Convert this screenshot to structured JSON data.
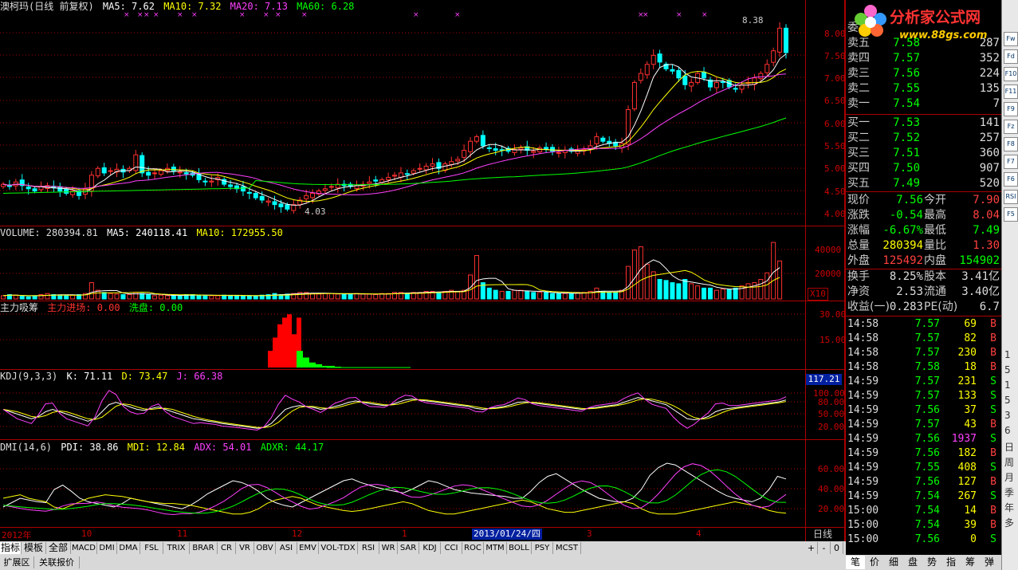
{
  "main_header": {
    "title": "澳柯玛(日线 前复权)",
    "ma5": "MA5: 7.62",
    "ma10": "MA10: 7.32",
    "ma20": "MA20: 7.13",
    "ma60": "MA60: 6.28"
  },
  "price_axis": [
    "8.00",
    "7.50",
    "7.00",
    "6.50",
    "6.00",
    "5.50",
    "5.00",
    "4.50",
    "4.00"
  ],
  "price_annotations": {
    "high": "8.38",
    "low": "4.03"
  },
  "volume_header": {
    "label": "VOLUME: 280394.81",
    "ma5": "MA5: 240118.41",
    "ma10": "MA10: 172955.50"
  },
  "volume_axis": [
    "40000",
    "20000"
  ],
  "volume_unit": "X10",
  "zljc_header": {
    "label": "主力吸筹",
    "in": "主力进场: 0.00",
    "out": "洗盘: 0.00"
  },
  "zljc_axis": [
    "30.00",
    "15.00"
  ],
  "kdj_header": {
    "label": "KDJ(9,3,3)",
    "k": "K: 71.11",
    "d": "D: 73.47",
    "j": "J: 66.38"
  },
  "kdj_axis": [
    "100.00",
    "80.00",
    "50.00",
    "20.00"
  ],
  "kdj_badge": "117.21",
  "dmi_header": {
    "label": "DMI(14,6)",
    "pdi": "PDI: 38.86",
    "mdi": "MDI: 12.84",
    "adx": "ADX: 54.01",
    "adxr": "ADXR: 44.17"
  },
  "dmi_axis": [
    "60.00",
    "40.00",
    "20.00"
  ],
  "date_axis": {
    "labels": [
      "2012年",
      "10",
      "11",
      "12",
      "1",
      "3",
      "4"
    ],
    "cursor_date": "2013/01/24/四",
    "period": "日线"
  },
  "indicator_tabs": [
    "指标",
    "模板",
    "全部",
    "MACD",
    "DMI",
    "DMA",
    "FSL",
    "TRIX",
    "BRAR",
    "CR",
    "VR",
    "OBV",
    "ASI",
    "EMV",
    "VOL-TDX",
    "RSI",
    "WR",
    "SAR",
    "KDJ",
    "CCI",
    "ROC",
    "MTM",
    "BOLL",
    "PSY",
    "MCST"
  ],
  "tab_controls": [
    "+",
    "-",
    "0"
  ],
  "bottom_tabs": [
    "扩展区",
    "关联报价"
  ],
  "logo": {
    "text": "分析家公式网",
    "url": "www.88gs.com"
  },
  "quote": {
    "wei": "委",
    "asks": [
      {
        "label": "卖五",
        "price": "7.58",
        "vol": "287"
      },
      {
        "label": "卖四",
        "price": "7.57",
        "vol": "352"
      },
      {
        "label": "卖三",
        "price": "7.56",
        "vol": "224"
      },
      {
        "label": "卖二",
        "price": "7.55",
        "vol": "135"
      },
      {
        "label": "卖一",
        "price": "7.54",
        "vol": "7"
      }
    ],
    "bids": [
      {
        "label": "买一",
        "price": "7.53",
        "vol": "141"
      },
      {
        "label": "买二",
        "price": "7.52",
        "vol": "257"
      },
      {
        "label": "买三",
        "price": "7.51",
        "vol": "360"
      },
      {
        "label": "买四",
        "price": "7.50",
        "vol": "907"
      },
      {
        "label": "买五",
        "price": "7.49",
        "vol": "520"
      }
    ],
    "stats": [
      {
        "l1": "现价",
        "v1": "7.56",
        "l2": "今开",
        "v2": "7.90"
      },
      {
        "l1": "涨跌",
        "v1": "-0.54",
        "l2": "最高",
        "v2": "8.04"
      },
      {
        "l1": "涨幅",
        "v1": "-6.67%",
        "l2": "最低",
        "v2": "7.49"
      },
      {
        "l1": "总量",
        "v1": "280394",
        "l2": "量比",
        "v2": "1.30"
      },
      {
        "l1": "外盘",
        "v1": "125492",
        "l2": "内盘",
        "v2": "154902"
      }
    ],
    "fund": [
      {
        "l1": "换手",
        "v1": "8.25%",
        "l2": "股本",
        "v2": "3.41亿"
      },
      {
        "l1": "净资",
        "v1": "2.53",
        "l2": "流通",
        "v2": "3.40亿"
      },
      {
        "l1": "收益(一)",
        "v1": "0.283",
        "l2": "PE(动)",
        "v2": "6.7"
      }
    ],
    "ticks": [
      {
        "t": "14:58",
        "p": "7.57",
        "v": "69",
        "s": "B"
      },
      {
        "t": "14:58",
        "p": "7.57",
        "v": "82",
        "s": "B"
      },
      {
        "t": "14:58",
        "p": "7.57",
        "v": "230",
        "s": "B"
      },
      {
        "t": "14:58",
        "p": "7.58",
        "v": "18",
        "s": "B"
      },
      {
        "t": "14:59",
        "p": "7.57",
        "v": "231",
        "s": "S"
      },
      {
        "t": "14:59",
        "p": "7.57",
        "v": "133",
        "s": "S"
      },
      {
        "t": "14:59",
        "p": "7.56",
        "v": "37",
        "s": "S"
      },
      {
        "t": "14:59",
        "p": "7.57",
        "v": "43",
        "s": "B"
      },
      {
        "t": "14:59",
        "p": "7.56",
        "v": "1937",
        "s": "S"
      },
      {
        "t": "14:59",
        "p": "7.56",
        "v": "182",
        "s": "B"
      },
      {
        "t": "14:59",
        "p": "7.55",
        "v": "408",
        "s": "S"
      },
      {
        "t": "14:59",
        "p": "7.56",
        "v": "127",
        "s": "B"
      },
      {
        "t": "14:59",
        "p": "7.54",
        "v": "267",
        "s": "S"
      },
      {
        "t": "15:00",
        "p": "7.54",
        "v": "14",
        "s": "B"
      },
      {
        "t": "15:00",
        "p": "7.54",
        "v": "39",
        "s": "B"
      },
      {
        "t": "15:00",
        "p": "7.56",
        "v": "0",
        "s": "S"
      }
    ],
    "bottom_tabs": [
      "笔",
      "价",
      "细",
      "盘",
      "势",
      "指",
      "筹",
      "弹"
    ]
  },
  "right_toolbar": {
    "buttons": [
      "Fw",
      "Fd",
      "F10",
      "F11",
      "F9",
      "Fz",
      "F8",
      "F7",
      "F6",
      "RSI",
      "F5"
    ],
    "chars": [
      "1",
      "5",
      "1",
      "5",
      "3",
      "6",
      "日",
      "周",
      "月",
      "季",
      "年",
      "多"
    ]
  },
  "colors": {
    "up": "#ff3030",
    "down": "#00ffff",
    "ma5": "#ffffff",
    "ma10": "#ffff00",
    "ma20": "#ff40ff",
    "ma60": "#00ff00",
    "grid": "#aa0000"
  },
  "chart_data": {
    "type": "candlestick",
    "price_range": [
      3.8,
      8.5
    ],
    "closes": [
      4.65,
      4.6,
      4.7,
      4.62,
      4.55,
      4.5,
      4.6,
      4.62,
      4.58,
      4.5,
      4.45,
      4.5,
      4.4,
      4.55,
      4.85,
      5.0,
      4.9,
      4.95,
      4.98,
      4.92,
      5.0,
      5.3,
      4.9,
      4.85,
      4.9,
      4.95,
      5.0,
      4.95,
      4.92,
      4.88,
      4.85,
      4.75,
      4.7,
      4.72,
      4.8,
      4.65,
      4.6,
      4.55,
      4.5,
      4.45,
      4.35,
      4.3,
      4.28,
      4.2,
      4.15,
      4.1,
      4.2,
      4.3,
      4.4,
      4.45,
      4.5,
      4.55,
      4.6,
      4.65,
      4.62,
      4.6,
      4.62,
      4.65,
      4.7,
      4.72,
      4.75,
      4.8,
      4.85,
      4.9,
      4.88,
      4.95,
      5.0,
      5.05,
      5.1,
      5.0,
      5.1,
      5.15,
      5.2,
      5.4,
      5.6,
      5.7,
      5.5,
      5.45,
      5.4,
      5.4,
      5.38,
      5.42,
      5.45,
      5.4,
      5.38,
      5.45,
      5.42,
      5.38,
      5.35,
      5.4,
      5.38,
      5.4,
      5.42,
      5.5,
      5.7,
      5.6,
      5.55,
      5.5,
      5.55,
      6.3,
      6.9,
      7.1,
      7.3,
      7.5,
      7.35,
      7.2,
      7.15,
      7.0,
      6.85,
      6.9,
      7.1,
      7.0,
      6.8,
      6.9,
      6.9,
      6.8,
      6.75,
      6.85,
      6.9,
      7.0,
      7.1,
      7.3,
      7.6,
      8.1,
      7.56
    ],
    "volume_range": [
      0,
      55000
    ],
    "volumes": [
      3000,
      4000,
      3500,
      2500,
      2000,
      3000,
      4000,
      5000,
      4000,
      3500,
      3000,
      3500,
      4000,
      5000,
      15000,
      8000,
      6000,
      5000,
      4500,
      4000,
      4000,
      6000,
      5000,
      4000,
      3000,
      3500,
      3000,
      3000,
      3500,
      4000,
      4000,
      3500,
      3000,
      3000,
      3000,
      3500,
      3000,
      3000,
      2800,
      3000,
      3000,
      3500,
      4000,
      5000,
      4000,
      4500,
      5000,
      6000,
      6000,
      5000,
      4500,
      5000,
      5000,
      4500,
      4500,
      4500,
      5000,
      4500,
      4500,
      4000,
      5000,
      5000,
      6000,
      6000,
      5000,
      6000,
      6000,
      7000,
      7000,
      6000,
      7000,
      8000,
      7000,
      8000,
      22000,
      40000,
      15000,
      10000,
      8000,
      7000,
      7000,
      8000,
      8000,
      7000,
      6000,
      6000,
      6000,
      5000,
      5000,
      5000,
      5000,
      6000,
      6000,
      7000,
      10000,
      7000,
      6000,
      6000,
      8000,
      30000,
      45000,
      48000,
      32000,
      25000,
      18000,
      17000,
      15000,
      14000,
      18000,
      14000,
      12000,
      10000,
      10000,
      8000,
      9000,
      9000,
      10000,
      12000,
      14000,
      15000,
      18000,
      24000,
      52000,
      35000
    ],
    "zljc": {
      "range": [
        0,
        35
      ],
      "red": [
        10,
        18,
        26,
        30,
        32,
        20,
        30
      ],
      "green": [
        10,
        6,
        3,
        2,
        1,
        1,
        0.5
      ]
    },
    "kdj": {
      "range": [
        0,
        120
      ],
      "k": [
        60,
        55,
        50,
        45,
        40,
        45,
        55,
        60,
        55,
        50,
        45,
        40,
        35,
        40,
        55,
        70,
        75,
        70,
        65,
        60,
        58,
        62,
        65,
        60,
        55,
        50,
        45,
        40,
        38,
        35,
        33,
        30,
        28,
        26,
        24,
        22,
        20,
        22,
        30,
        45,
        60,
        65,
        68,
        66,
        64,
        60,
        62,
        66,
        70,
        75,
        78,
        75,
        72,
        70,
        68,
        70,
        75,
        80,
        82,
        80,
        78,
        76,
        74,
        72,
        70,
        68,
        66,
        62,
        60,
        62,
        64,
        66,
        70,
        75,
        76,
        74,
        72,
        70,
        68,
        66,
        64,
        62,
        60,
        62,
        64,
        66,
        68,
        70,
        75,
        80,
        85,
        82,
        78,
        74,
        70,
        60,
        50,
        40,
        38,
        40,
        45,
        55,
        60,
        62,
        64,
        66,
        68,
        70,
        72,
        74,
        76,
        80
      ]
    },
    "dmi": {
      "range": [
        0,
        80
      ],
      "pdi": [
        20,
        25,
        30,
        28,
        26,
        25,
        40,
        45,
        38,
        30,
        26,
        24,
        22,
        20,
        24,
        30,
        28,
        26,
        24,
        22,
        20,
        18,
        22,
        28,
        35,
        40,
        45,
        50,
        48,
        44,
        38,
        30,
        25,
        22,
        20,
        25,
        30,
        35,
        40,
        45,
        50,
        52,
        48,
        45,
        42,
        40,
        38,
        36,
        40,
        45,
        50,
        48,
        44,
        40,
        38,
        36,
        35,
        34,
        33,
        32,
        30,
        30,
        38,
        48,
        55,
        58,
        52,
        46,
        40,
        35,
        30,
        28,
        26,
        26,
        30,
        40,
        56,
        65,
        70,
        68,
        62,
        56,
        50,
        44,
        38,
        33,
        30,
        28,
        26,
        30,
        40,
        55,
        52
      ],
      "mdi": [
        30,
        32,
        34,
        30,
        28,
        26,
        20,
        18,
        22,
        26,
        30,
        32,
        34,
        33,
        32,
        30,
        28,
        26,
        25,
        24,
        24,
        23,
        22,
        20,
        18,
        16,
        14,
        12,
        12,
        14,
        18,
        24,
        28,
        30,
        32,
        30,
        26,
        22,
        20,
        18,
        16,
        15,
        16,
        18,
        20,
        22,
        24,
        26,
        24,
        20,
        16,
        14,
        12,
        12,
        14,
        16,
        18,
        20,
        22,
        24,
        26,
        28,
        26,
        22,
        18,
        16,
        14,
        14,
        16,
        18,
        20,
        22,
        24,
        26,
        24,
        18,
        14,
        12,
        12,
        12,
        14,
        16,
        18,
        20,
        22,
        24,
        26,
        24,
        22,
        20,
        16,
        14,
        13
      ]
    }
  }
}
